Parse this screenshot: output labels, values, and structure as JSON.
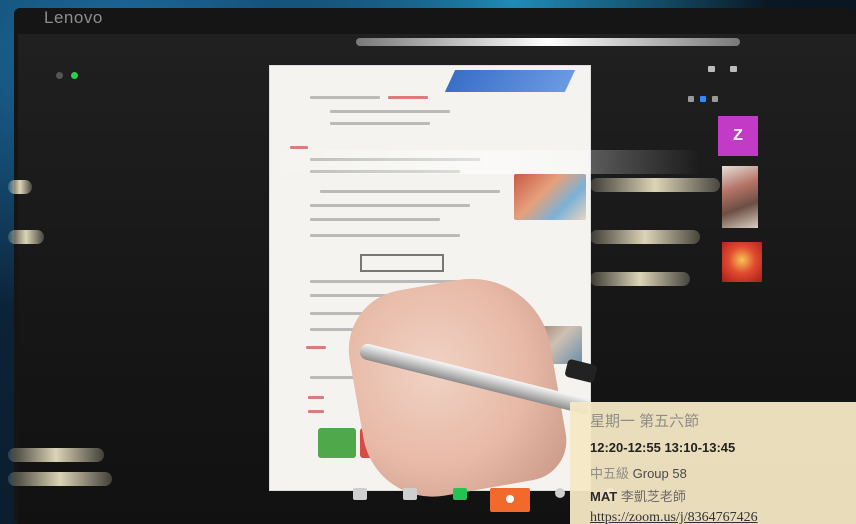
{
  "monitor": {
    "brand": "Lenovo"
  },
  "zoom_panel": {
    "view_label": "",
    "speaker_label": "",
    "participants": [
      {
        "initial": "Z",
        "name": "",
        "avatar_color": "#c23bc7"
      },
      {
        "initial": "",
        "name": ""
      },
      {
        "initial": "",
        "name": ""
      }
    ]
  },
  "toolbar": {
    "buttons": [
      {
        "label": ""
      },
      {
        "label": ""
      },
      {
        "label": ""
      },
      {
        "label": ""
      },
      {
        "label": ""
      },
      {
        "label": ""
      }
    ],
    "share_color": "#23c552",
    "react_color": "#f26a2b"
  },
  "overlay": {
    "day_period": "星期一 第五六節",
    "times": "12:20-12:55 13:10-13:45",
    "grade_prefix": "中五級",
    "group": "Group 58",
    "subject": "MAT",
    "teacher": "李凱芝老師",
    "url": "https://zoom.us/j/8364767426",
    "background": "#f4e8c4"
  }
}
